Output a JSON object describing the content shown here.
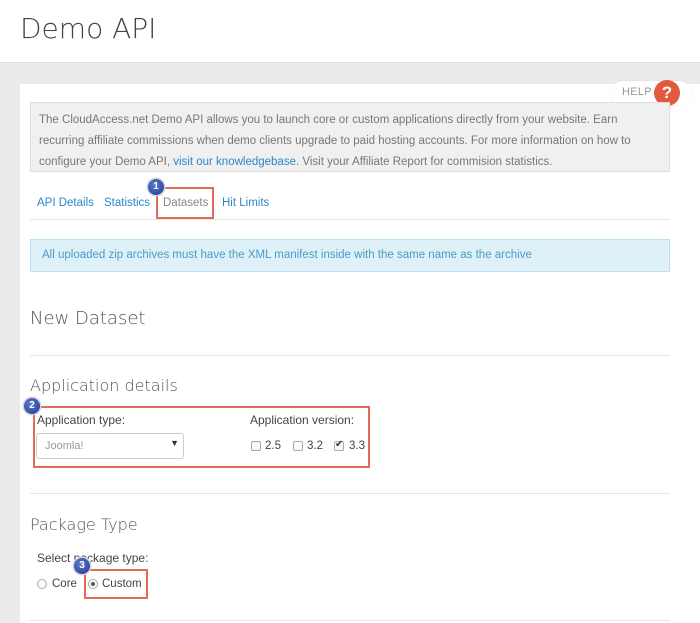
{
  "header": {
    "title": "Demo API"
  },
  "help": {
    "label": "HELP",
    "icon_glyph": "?"
  },
  "intro": {
    "text_before": "The CloudAccess.net Demo API allows you to launch core or custom applications directly from your website. Earn recurring affiliate commissions when demo clients upgrade to paid hosting accounts. For more information on how to configure your Demo API, ",
    "link_text": "visit our knowledgebase",
    "text_after": ". Visit your Affiliate Report for commision statistics."
  },
  "tabs": [
    {
      "label": "API Details",
      "active": false
    },
    {
      "label": "Statistics",
      "active": false
    },
    {
      "label": "Datasets",
      "active": true
    },
    {
      "label": "Hit Limits",
      "active": false
    }
  ],
  "info_alert": "All uploaded zip archives must have the XML manifest inside with the same name as the archive",
  "new_dataset": {
    "title": "New Dataset"
  },
  "application_details": {
    "title": "Application details",
    "type_label": "Application type:",
    "type_value": "Joomla!",
    "version_label": "Application version:",
    "versions": [
      {
        "label": "2.5",
        "checked": false
      },
      {
        "label": "3.2",
        "checked": false
      },
      {
        "label": "3.3",
        "checked": true
      }
    ]
  },
  "package_type": {
    "title": "Package Type",
    "select_label": "Select package type:",
    "options": [
      {
        "label": "Core",
        "selected": false
      },
      {
        "label": "Custom",
        "selected": true
      }
    ]
  },
  "markers": [
    "1",
    "2",
    "3"
  ],
  "colors": {
    "link": "#2a87c8",
    "help": "#e05a3b",
    "highlight": "#e36a58",
    "alert_bg": "#def1f8",
    "marker": "#2a44a0"
  }
}
